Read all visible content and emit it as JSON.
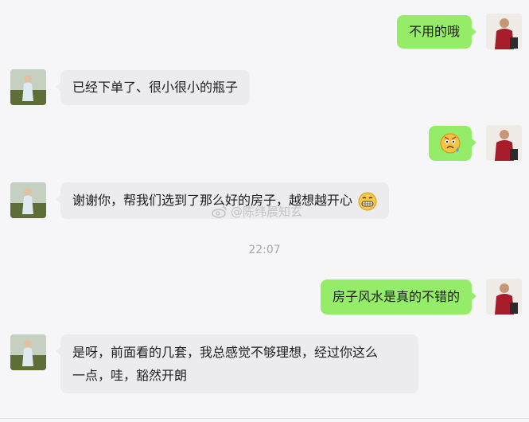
{
  "messages": [
    {
      "side": "right",
      "text": "不用的哦"
    },
    {
      "side": "left",
      "text": "已经下单了、很小很小的瓶子"
    },
    {
      "side": "right",
      "text": "",
      "emoji": "sticker-face-icon"
    },
    {
      "side": "left",
      "text": "谢谢你，帮我们选到了那么好的房子，越想越开心",
      "emoji": "grin-face-icon"
    },
    {
      "side": "right",
      "text": "房子风水是真的不错的"
    },
    {
      "side": "left",
      "text_line1": "是呀，前面看的几套，我总感觉不够理想，经过你这么",
      "text_line2": "一点，哇，豁然开朗"
    }
  ],
  "timestamp": "22:07",
  "watermark": "@陈纬晨知玄",
  "colors": {
    "right_bubble": "#95ec69",
    "left_bubble": "#ececee",
    "background": "#f6f6f8"
  }
}
